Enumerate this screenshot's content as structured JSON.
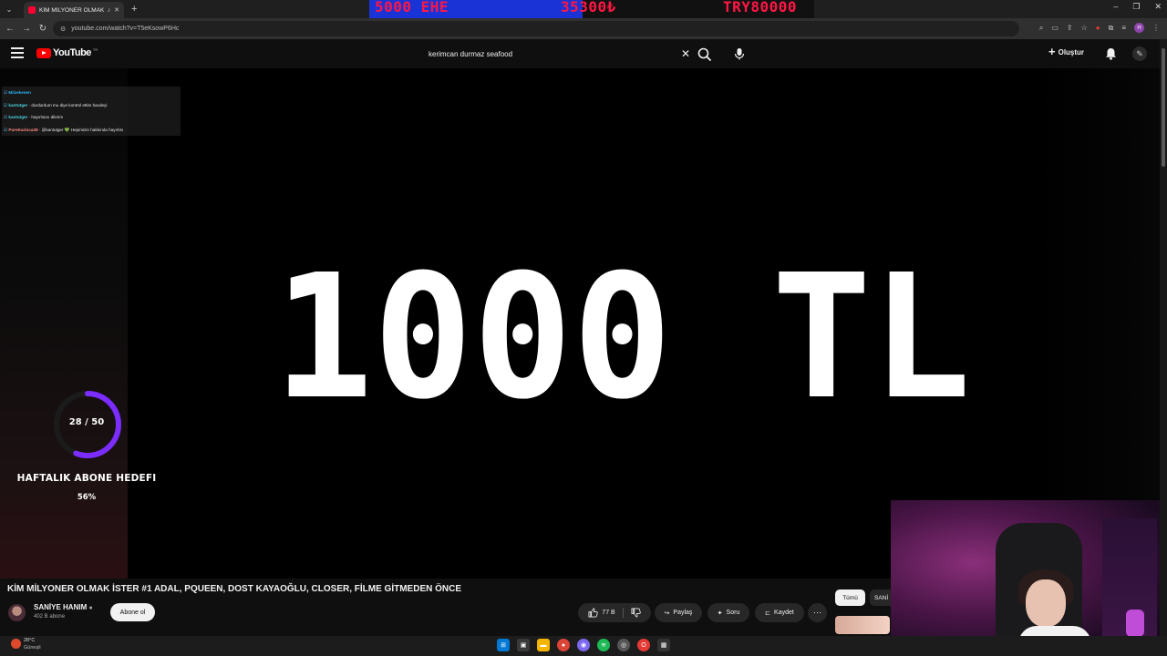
{
  "browser": {
    "tab_title": "KİM MİLYONER OLMAK İSTE...",
    "url": "youtube.com/watch?v=T5eKsowP6Hc"
  },
  "ticker": {
    "left": "5000 EHE",
    "middle": "35300₺",
    "right": "TRY80000"
  },
  "header": {
    "logo": "YouTube",
    "logo_region": "TR",
    "search_value": "kerimcan durmaz seafood",
    "create_label": "Oluştur"
  },
  "overlay": {
    "chat": [
      {
        "user": "Miizekenen",
        "message": "",
        "user_color": "blue"
      },
      {
        "user": "kantutger",
        "message": "durdurdum mu diye kontrol ettim hacdeyi",
        "user_color": "teal"
      },
      {
        "user": "kantutger",
        "message": "hayırlısını dilerim",
        "user_color": "teal"
      },
      {
        "user": "PureKarinca28",
        "message": "@kantutger 💚 Hepimizin hakkında hayırlısı",
        "user_color": "pink"
      }
    ],
    "big_text": "1000 TL",
    "goal": {
      "count": "28 / 50",
      "current": 28,
      "target": 50,
      "title": "HAFTALIK ABONE HEDEFI",
      "percent_label": "56%"
    }
  },
  "video": {
    "title": "KİM MİLYONER OLMAK İSTER #1 ADAL, PQUEEN, DOST KAYAOĞLU, CLOSER, FİLME GİTMEDEN ÖNCE",
    "channel": "SANİYE HANIM",
    "subscribers": "402 B abone",
    "subscribe_label": "Abone ol",
    "likes": "77 B",
    "share_label": "Paylaş",
    "ask_label": "Soru",
    "save_label": "Kaydet"
  },
  "chips": {
    "all": "Tümü",
    "sani": "SANİ"
  },
  "taskbar": {
    "temp": "28°C",
    "weather": "Güneşli"
  }
}
